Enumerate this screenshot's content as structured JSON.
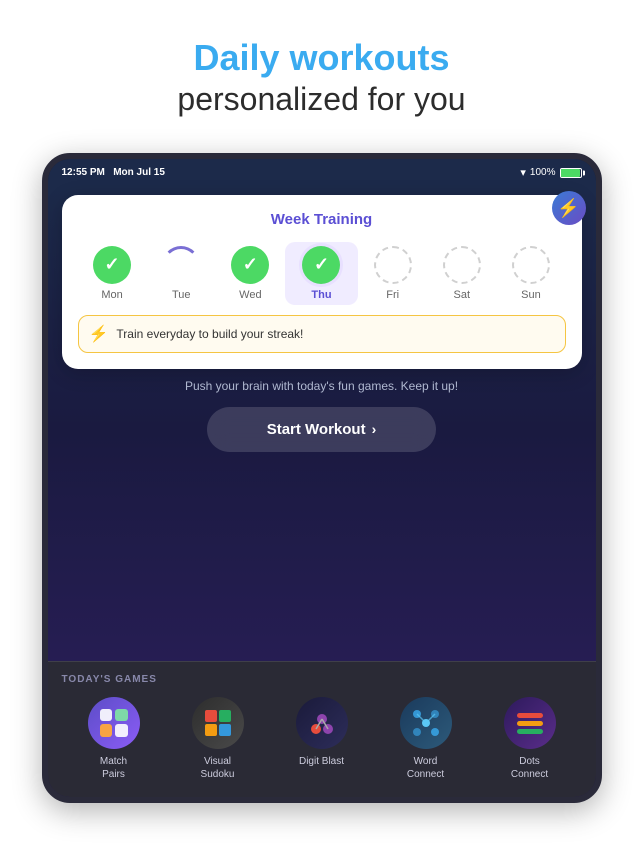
{
  "header": {
    "title_main": "Daily workouts",
    "title_sub": "personalized for you"
  },
  "status_bar": {
    "time": "12:55 PM",
    "date": "Mon Jul 15",
    "wifi": "WiFi",
    "battery": "100%"
  },
  "week_training": {
    "title": "Week Training",
    "days": [
      {
        "label": "Mon",
        "state": "completed"
      },
      {
        "label": "Tue",
        "state": "loading"
      },
      {
        "label": "Wed",
        "state": "completed"
      },
      {
        "label": "Thu",
        "state": "active"
      },
      {
        "label": "Fri",
        "state": "empty"
      },
      {
        "label": "Sat",
        "state": "empty"
      },
      {
        "label": "Sun",
        "state": "empty"
      }
    ],
    "streak_message": "Train everyday to build your streak!"
  },
  "workout_section": {
    "subtitle": "Push your brain with today's fun games. Keep it up!",
    "button_label": "Start Workout"
  },
  "todays_games": {
    "section_label": "TODAY'S GAMES",
    "games": [
      {
        "name": "Match\nPairs",
        "icon_type": "match-pairs"
      },
      {
        "name": "Visual\nSudoku",
        "icon_type": "visual-sudoku"
      },
      {
        "name": "Digit Blast",
        "icon_type": "digit-blast"
      },
      {
        "name": "Word\nConnect",
        "icon_type": "word-connect"
      },
      {
        "name": "Dots\nConnect",
        "icon_type": "dots-connect"
      }
    ]
  }
}
